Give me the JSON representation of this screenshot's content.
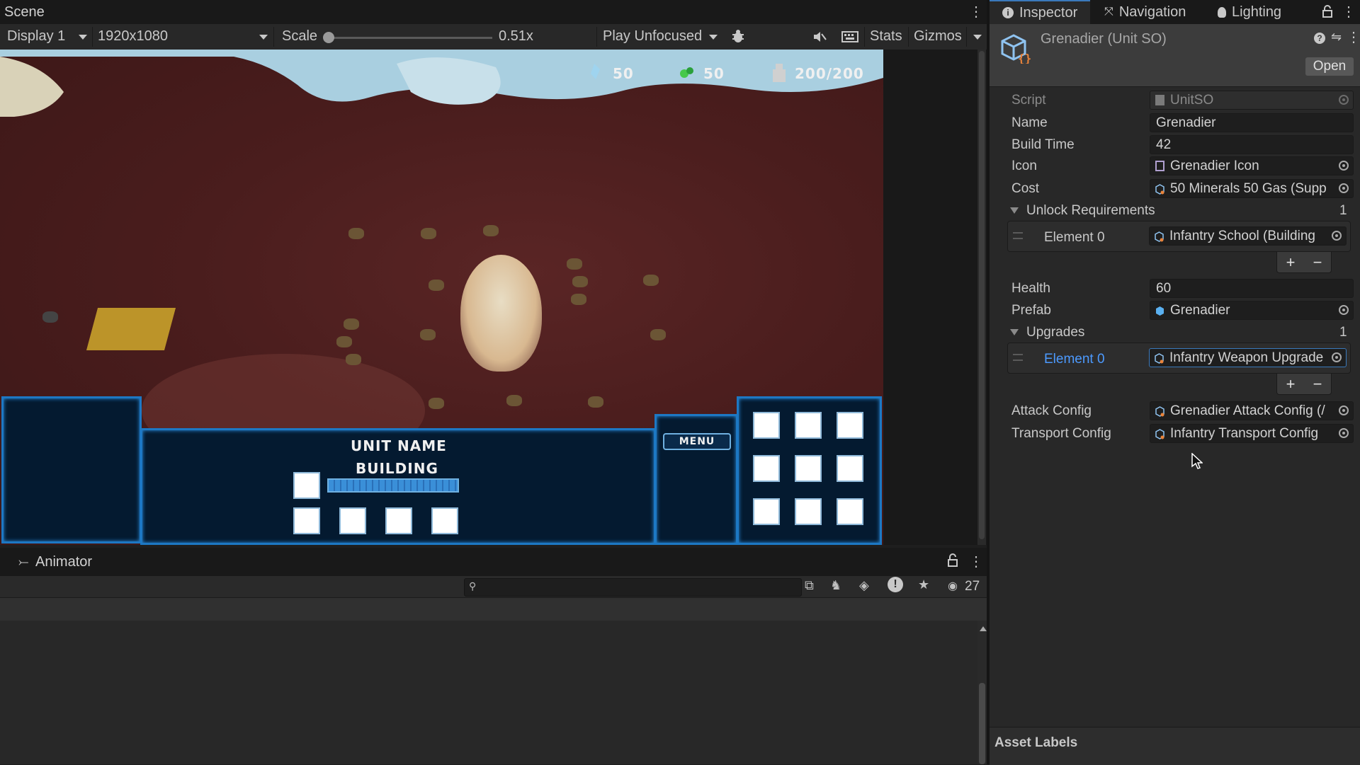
{
  "scene": {
    "title": "Scene",
    "display": "Display 1",
    "resolution": "1920x1080",
    "scale_label": "Scale",
    "scale_value": "0.51x",
    "play_mode": "Play Unfocused",
    "stats": "Stats",
    "gizmos": "Gizmos"
  },
  "game_hud": {
    "minerals": "50",
    "gas": "50",
    "supply": "200/200",
    "unit_name": "UNIT NAME",
    "status": "BUILDING",
    "menu": "MENU",
    "build_progress": 1.0
  },
  "animator": {
    "title": "Animator",
    "visible_count": "27"
  },
  "inspector": {
    "tabs": [
      "Inspector",
      "Navigation",
      "Lighting"
    ],
    "object_title": "Grenadier (Unit SO)",
    "open_button": "Open",
    "fields": {
      "script_label": "Script",
      "script_value": "UnitSO",
      "name_label": "Name",
      "name_value": "Grenadier",
      "build_time_label": "Build Time",
      "build_time_value": "42",
      "icon_label": "Icon",
      "icon_value": "Grenadier Icon",
      "cost_label": "Cost",
      "cost_value": "50 Minerals 50 Gas (Supp",
      "unlock_label": "Unlock Requirements",
      "unlock_count": "1",
      "unlock_element_label": "Element 0",
      "unlock_element_value": "Infantry School (Building",
      "health_label": "Health",
      "health_value": "60",
      "prefab_label": "Prefab",
      "prefab_value": "Grenadier",
      "upgrades_label": "Upgrades",
      "upgrades_count": "1",
      "upgrade_element_label": "Element 0",
      "upgrade_element_value": "Infantry Weapon Upgrade",
      "attack_label": "Attack Config",
      "attack_value": "Grenadier Attack Config (/",
      "transport_label": "Transport Config",
      "transport_value": "Infantry Transport Config"
    },
    "asset_labels": "Asset Labels"
  },
  "colors": {
    "accent": "#3a79bb",
    "selected_element": "#4c9aff",
    "hud_border": "#1d78c4",
    "hud_panel": "#041a30"
  }
}
